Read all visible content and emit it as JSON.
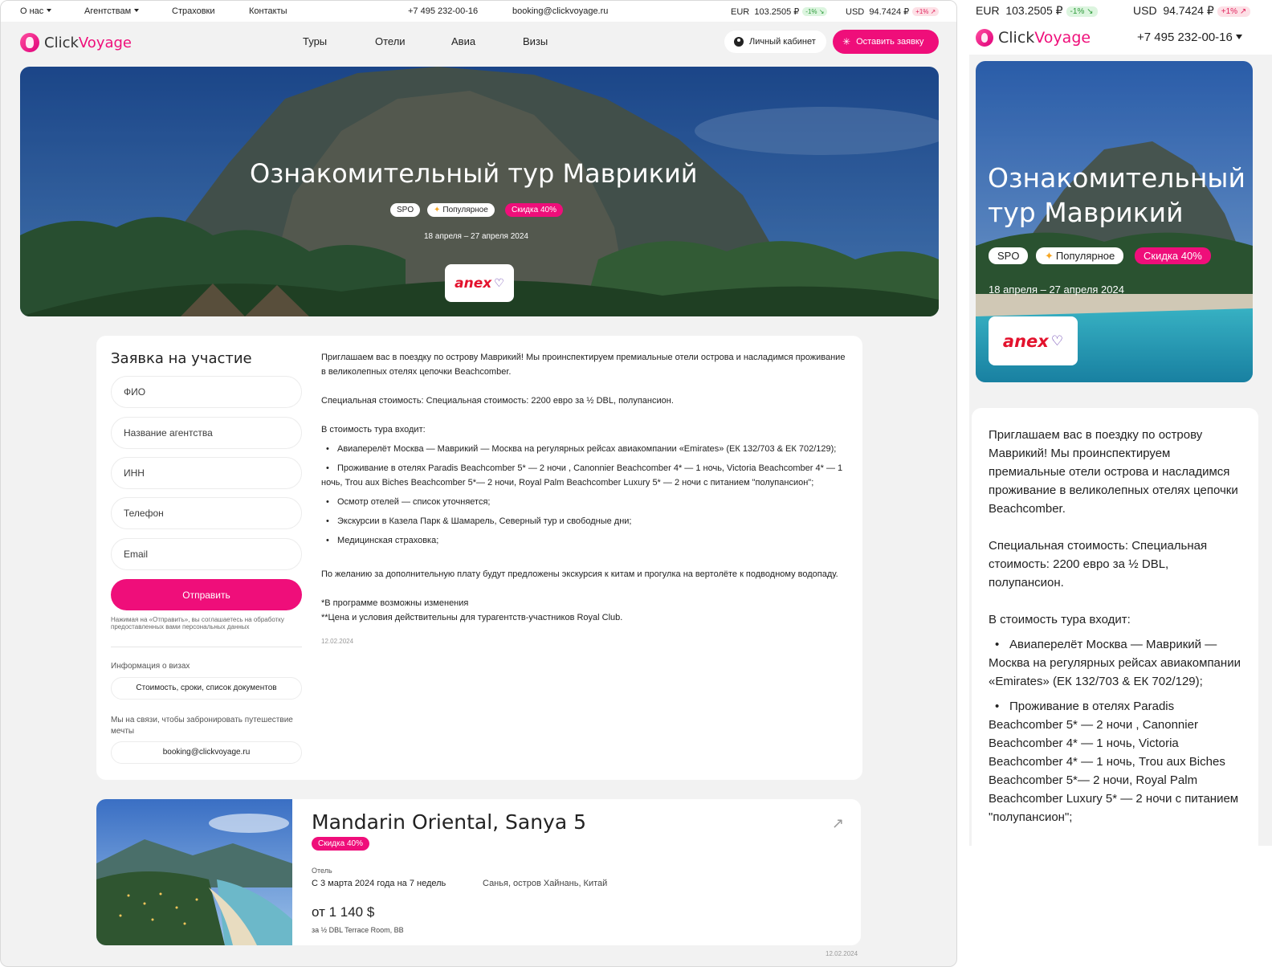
{
  "topbar": {
    "about": "О нас",
    "agencies": "Агентствам",
    "insurance": "Страховки",
    "contacts": "Контакты",
    "phone": "+7 495 232-00-16",
    "email": "booking@clickvoyage.ru",
    "eur_label": "EUR",
    "eur_value": "103.2505 ₽",
    "eur_change": "-1% ↘",
    "usd_label": "USD",
    "usd_value": "94.7424 ₽",
    "usd_change": "+1% ↗"
  },
  "brand": {
    "part1": "Click",
    "part2": "Voyage",
    "accent_color": "#ef0e7a"
  },
  "nav": {
    "tours": "Туры",
    "hotels": "Отели",
    "avia": "Авиа",
    "visas": "Визы",
    "cabinet": "Личный кабинет",
    "apply": "Оставить заявку"
  },
  "hero": {
    "title": "Ознакомительный тур Маврикий",
    "badges": {
      "spo": "SPO",
      "popular": "Популярное",
      "discount": "Скидка 40%"
    },
    "dates": "18 апреля – 27 апреля 2024",
    "operator_logo": "anex"
  },
  "form": {
    "title": "Заявка на участие",
    "fio_placeholder": "ФИО",
    "agency_placeholder": "Название агентства",
    "inn_placeholder": "ИНН",
    "phone_placeholder": "Телефон",
    "email_placeholder": "Email",
    "submit": "Отправить",
    "consent": "Нажимая на «Отправить», вы соглашаетесь на обработку предоставленных вами персональных данных",
    "visa_label": "Информация о визах",
    "visa_button": "Стоимость, сроки, список документов",
    "contact_label": "Мы на связи, чтобы забронировать путешествие мечты",
    "contact_email": "booking@clickvoyage.ru"
  },
  "description": {
    "intro": "Приглашаем вас в поездку по острову Маврикий! Мы проинспектируем премиальные отели острова и насладимся проживание в великолепных отелях цепочки Beachcomber.",
    "price": "Специальная стоимость: Специальная стоимость: 2200 евро за ½ DBL, полупансион.",
    "includes_title": "В стоимость тура входит:",
    "includes": [
      "Авиаперелёт Москва — Маврикий — Москва на регулярных рейсах авиакомпании «Emirates» (ЕК 132/703 & ЕК 702/129);",
      "Проживание в отелях Paradis Beachcomber 5* — 2 ночи , Canonnier Beachcomber 4* — 1 ночь, Victoria Beachcomber 4* — 1 ночь, Trou aux Biches Beachcomber 5*— 2 ночи, Royal Palm Beachcomber Luxury 5* — 2 ночи с питанием \"полупансион\";",
      "Осмотр отелей — список уточняется;",
      "Экскурсии в Казела Парк & Шамарель, Северный тур и свободные дни;",
      "Медицинская страховка;"
    ],
    "extra": "По желанию за дополнительную плату будут предложены экскурсия к китам и прогулка на вертолёте к подводному водопаду.",
    "note1": "*В программе возможны изменения",
    "note2": "**Цена и условия действительны для турагентств-участников Royal Club.",
    "date": "12.02.2024"
  },
  "hotel": {
    "name": "Mandarin Oriental, Sanya 5",
    "discount": "Скидка 40%",
    "kind": "Отель",
    "dates": "С 3 марта 2024 года на 7 недель",
    "location": "Санья, остров Хайнань, Китай",
    "price": "от 1 140 $",
    "room": "за ½ DBL Terrace Room, BB",
    "date": "12.02.2024"
  },
  "mobile": {
    "eur_label": "EUR",
    "eur_value": "103.2505 ₽",
    "eur_change": "-1% ↘",
    "usd_label": "USD",
    "usd_value": "94.7424 ₽",
    "usd_change": "+1% ↗",
    "phone": "+7 495 232-00-16"
  }
}
